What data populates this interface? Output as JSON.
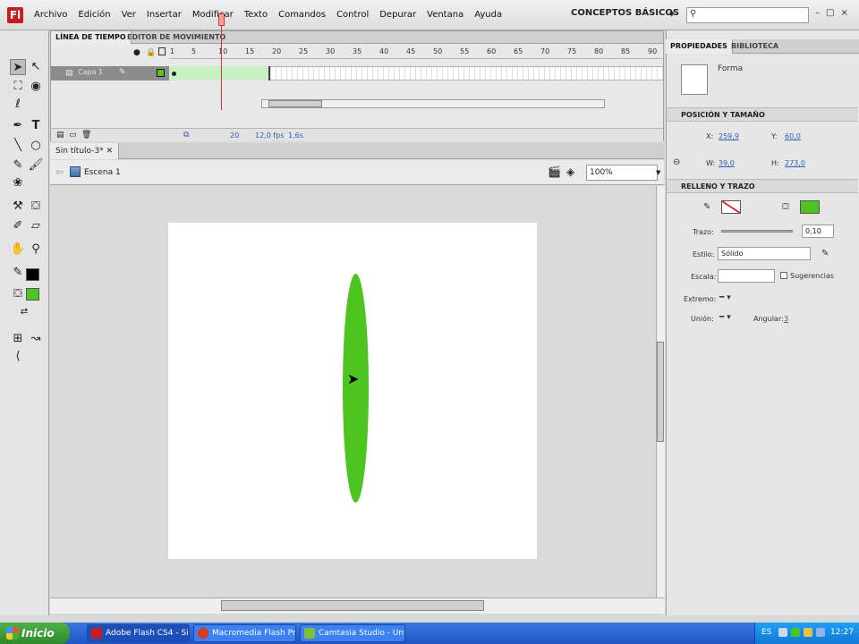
{
  "app": {
    "logo_letter": "Fl",
    "menu": [
      "Archivo",
      "Edición",
      "Ver",
      "Insertar",
      "Modificar",
      "Texto",
      "Comandos",
      "Control",
      "Depurar",
      "Ventana",
      "Ayuda"
    ],
    "workspace": "CONCEPTOS BÁSICOS",
    "window_controls": [
      "–",
      "□",
      "×"
    ]
  },
  "timeline": {
    "tabs": [
      "LÍNEA DE TIEMPO",
      "EDITOR DE MOVIMIENTO"
    ],
    "frame_numbers": [
      "1",
      "5",
      "10",
      "15",
      "20",
      "25",
      "30",
      "35",
      "40",
      "45",
      "50",
      "55",
      "60",
      "65",
      "70",
      "75",
      "80",
      "85",
      "90"
    ],
    "layer_name": "Capa 1",
    "current_frame": "20",
    "fps": "12,0 fps",
    "time": "1,6s"
  },
  "document": {
    "tab_title": "Sin título-3*",
    "scene": "Escena 1",
    "zoom": "100%"
  },
  "properties": {
    "tabs": [
      "PROPIEDADES",
      "BIBLIOTECA"
    ],
    "object_type": "Forma",
    "section_position": "POSICIÓN Y TAMAÑO",
    "x_label": "X:",
    "x_value": "259,9",
    "y_label": "Y:",
    "y_value": "60,0",
    "w_label": "W:",
    "w_value": "39,0",
    "h_label": "H:",
    "h_value": "273,0",
    "section_fill": "RELLENO Y TRAZO",
    "stroke_label": "Trazo:",
    "stroke_value": "0,10",
    "style_label": "Estilo:",
    "style_value": "Sólido",
    "scale_label": "Escala:",
    "hints_label": "Sugerencias",
    "cap_label": "Extremo:",
    "join_label": "Unión:",
    "angle_label": "Angular:",
    "angle_value": "3"
  },
  "taskbar": {
    "start": "Inicio",
    "items": [
      "Adobe Flash CS4 - Si...",
      "Macromedia Flash Pro...",
      "Camtasia Studio - Unt..."
    ],
    "lang": "ES",
    "clock": "12:27"
  },
  "colors": {
    "fill": "#4ec420",
    "stroke": "#000000",
    "stage": "#ffffff"
  }
}
